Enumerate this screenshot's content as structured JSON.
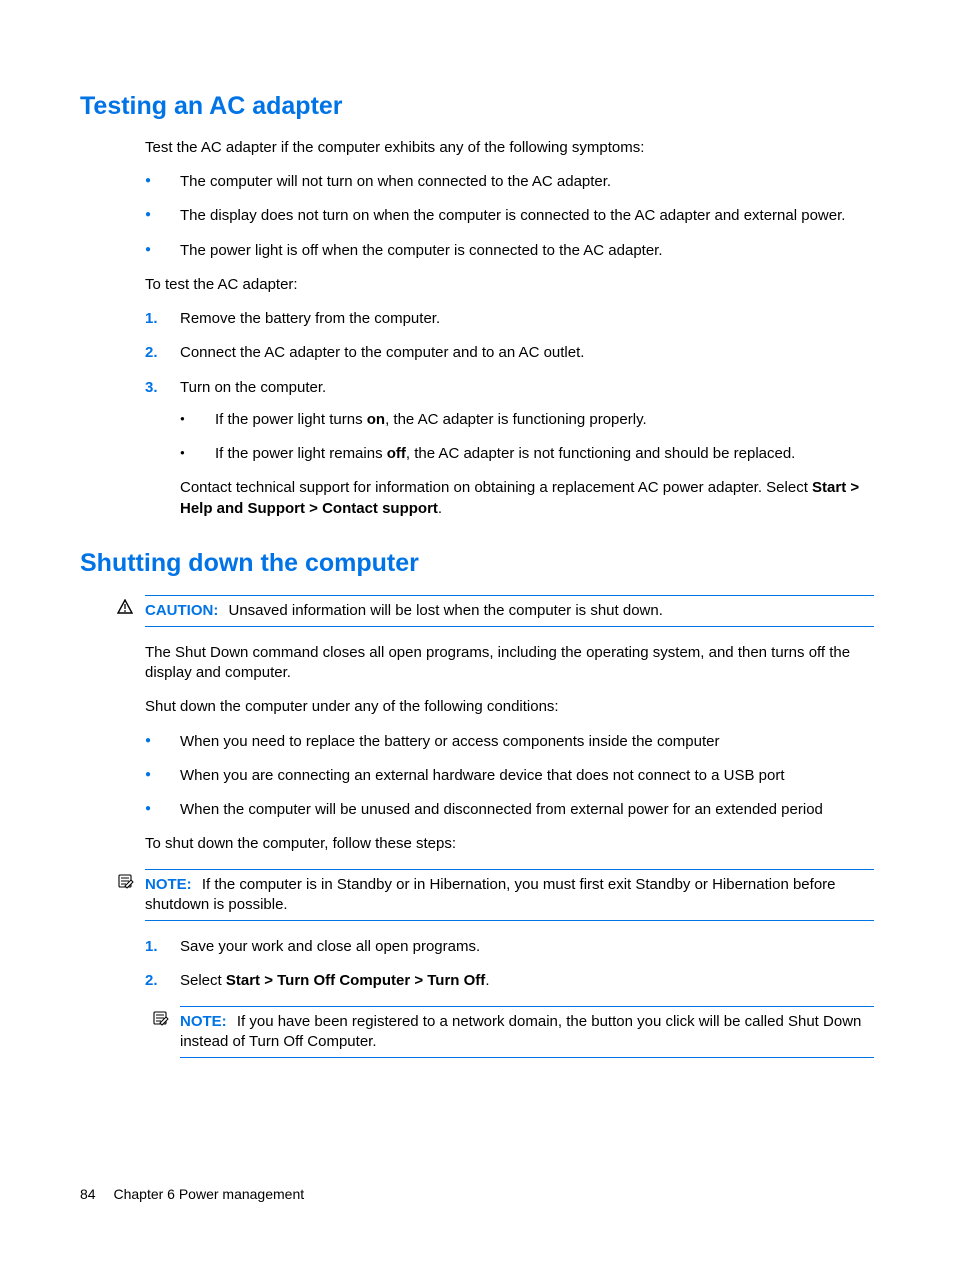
{
  "section1": {
    "heading": "Testing an AC adapter",
    "intro": "Test the AC adapter if the computer exhibits any of the following symptoms:",
    "symptoms": [
      "The computer will not turn on when connected to the AC adapter.",
      "The display does not turn on when the computer is connected to the AC adapter and external power.",
      "The power light is off when the computer is connected to the AC adapter."
    ],
    "toTest": "To test the AC adapter:",
    "steps": {
      "s1": "Remove the battery from the computer.",
      "s2": "Connect the AC adapter to the computer and to an AC outlet.",
      "s3": "Turn on the computer."
    },
    "sub": {
      "a_pre": "If the power light turns ",
      "a_bold": "on",
      "a_post": ", the AC adapter is functioning properly.",
      "b_pre": "If the power light remains ",
      "b_bold": "off",
      "b_post": ", the AC adapter is not functioning and should be replaced."
    },
    "contact_pre": "Contact technical support for information on obtaining a replacement AC power adapter. Select ",
    "contact_bold": "Start > Help and Support > Contact support",
    "contact_post": "."
  },
  "section2": {
    "heading": "Shutting down the computer",
    "caution_label": "CAUTION:",
    "caution_text": "Unsaved information will be lost when the computer is shut down.",
    "p1": "The Shut Down command closes all open programs, including the operating system, and then turns off the display and computer.",
    "p2": "Shut down the computer under any of the following conditions:",
    "conditions": [
      "When you need to replace the battery or access components inside the computer",
      "When you are connecting an external hardware device that does not connect to a USB port",
      "When the computer will be unused and disconnected from external power for an extended period"
    ],
    "p3": "To shut down the computer, follow these steps:",
    "note1_label": "NOTE:",
    "note1_text": "If the computer is in Standby or in Hibernation, you must first exit Standby or Hibernation before shutdown is possible.",
    "steps": {
      "s1": "Save your work and close all open programs.",
      "s2_pre": "Select ",
      "s2_bold": "Start > Turn Off Computer > Turn Off",
      "s2_post": "."
    },
    "note2_label": "NOTE:",
    "note2_text": "If you have been registered to a network domain, the button you click will be called Shut Down instead of Turn Off Computer."
  },
  "footer": {
    "page": "84",
    "chapter": "Chapter 6   Power management"
  }
}
